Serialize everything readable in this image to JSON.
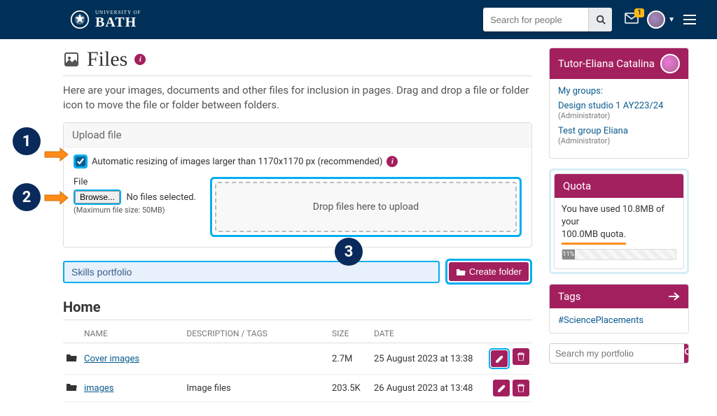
{
  "header": {
    "logo_top": "UNIVERSITY OF",
    "logo_main": "BATH",
    "search_placeholder": "Search for people",
    "mail_badge": "1"
  },
  "page": {
    "title": "Files",
    "intro": "Here are your images, documents and other files for inclusion in pages. Drag and drop a file or folder icon to move the file or folder between folders."
  },
  "upload": {
    "panel_title": "Upload file",
    "resize_label": "Automatic resizing of images larger than 1170x1170 px (recommended)",
    "file_label": "File",
    "browse_label": "Browse...",
    "no_file_text": "No files selected.",
    "max_note": "(Maximum file size: 50MB)",
    "dropzone_text": "Drop files here to upload"
  },
  "folder": {
    "input_value": "Skills portfolio",
    "create_label": "Create folder"
  },
  "files": {
    "section_title": "Home",
    "columns": {
      "name": "NAME",
      "desc": "DESCRIPTION / TAGS",
      "size": "SIZE",
      "date": "DATE"
    },
    "rows": [
      {
        "name": "Cover images",
        "desc": "",
        "size": "2.7M",
        "date": "25 August 2023 at 13:38",
        "highlight_edit": true
      },
      {
        "name": "images",
        "desc": "Image files",
        "size": "203.5K",
        "date": "26 August 2023 at 13:48",
        "highlight_edit": false
      }
    ]
  },
  "tutor": {
    "head": "Tutor-Eliana Catalina",
    "groups_label": "My groups:",
    "groups": [
      {
        "name": "Design studio 1 AY223/24",
        "role": "(Administrator)"
      },
      {
        "name": "Test group Eliana",
        "role": "(Administrator)"
      }
    ]
  },
  "quota": {
    "head": "Quota",
    "text_a": "You have used 10.8MB of your",
    "text_b": "100.0MB quota.",
    "percent": "11%"
  },
  "tags": {
    "head": "Tags",
    "tag": "#SciencePlacements"
  },
  "side_search": {
    "placeholder": "Search my portfolio"
  },
  "annotations": {
    "n1": "1",
    "n2": "2",
    "n3": "3"
  }
}
